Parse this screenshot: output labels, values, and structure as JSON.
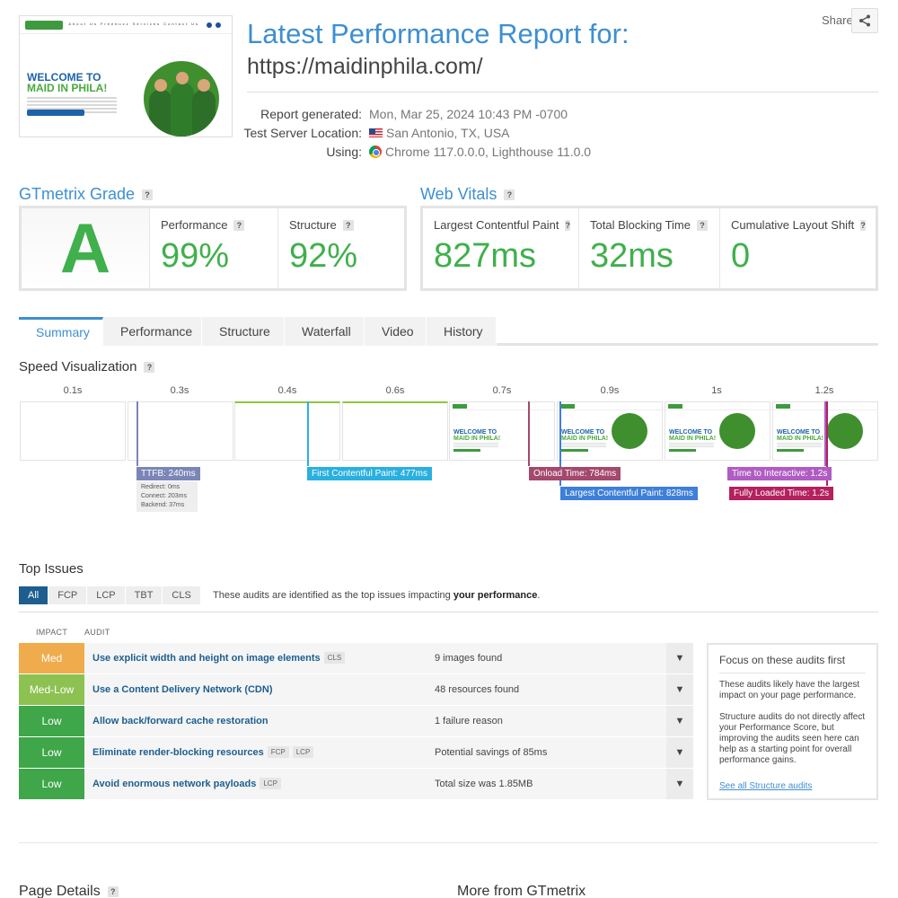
{
  "header": {
    "title": "Latest Performance Report for:",
    "url": "https://maidinphila.com/",
    "share_label": "Share",
    "share_icon": "share-icon",
    "thumbnail": {
      "welcome_line1": "WELCOME TO",
      "welcome_line2": "MAID IN PHILA!",
      "nav_links": "About Us   Freebuzz   Services   Contact Us"
    },
    "meta": [
      {
        "label": "Report generated:",
        "value": "Mon, Mar 25, 2024 10:43 PM -0700",
        "icon": ""
      },
      {
        "label": "Test Server Location:",
        "value": "San Antonio, TX, USA",
        "icon": "us-flag-icon"
      },
      {
        "label": "Using:",
        "value": "Chrome 117.0.0.0, Lighthouse 11.0.0",
        "icon": "chrome-icon"
      }
    ]
  },
  "grade": {
    "title": "GTmetrix Grade",
    "letter": "A",
    "performance_label": "Performance",
    "performance_value": "99%",
    "structure_label": "Structure",
    "structure_value": "92%"
  },
  "vitals": {
    "title": "Web Vitals",
    "items": [
      {
        "label": "Largest Contentful Paint",
        "value": "827ms"
      },
      {
        "label": "Total Blocking Time",
        "value": "32ms"
      },
      {
        "label": "Cumulative Layout Shift",
        "value": "0"
      }
    ]
  },
  "tabs": [
    "Summary",
    "Performance",
    "Structure",
    "Waterfall",
    "Video",
    "History"
  ],
  "active_tab": "Summary",
  "speed": {
    "title": "Speed Visualization",
    "times": [
      "0.1s",
      "0.3s",
      "0.4s",
      "0.6s",
      "0.7s",
      "0.9s",
      "1s",
      "1.2s"
    ],
    "markers": {
      "ttfb": "TTFB: 240ms",
      "redirect": "Redirect: 0ms",
      "connect": "Connect: 203ms",
      "backend": "Backend: 37ms",
      "fcp": "First Contentful Paint: 477ms",
      "onload": "Onload Time: 784ms",
      "lcp": "Largest Contentful Paint: 828ms",
      "tti": "Time to Interactive: 1.2s",
      "fully_loaded": "Fully Loaded Time: 1.2s"
    },
    "frame_text_1": "WELCOME TO",
    "frame_text_2": "MAID IN PHILA!"
  },
  "issues": {
    "title": "Top Issues",
    "filters": [
      "All",
      "FCP",
      "LCP",
      "TBT",
      "CLS"
    ],
    "active_filter": "All",
    "desc_prefix": "These audits are identified as the top issues impacting ",
    "desc_bold": "your performance",
    "desc_suffix": ".",
    "col_impact": "IMPACT",
    "col_audit": "AUDIT",
    "rows": [
      {
        "impact": "Med",
        "color": "#f0ac4c",
        "audit": "Use explicit width and height on image elements",
        "tags": [
          "CLS"
        ],
        "result": "9 images found"
      },
      {
        "impact": "Med-Low",
        "color": "#8dc152",
        "audit": "Use a Content Delivery Network (CDN)",
        "tags": [],
        "result": "48 resources found"
      },
      {
        "impact": "Low",
        "color": "#3fa64a",
        "audit": "Allow back/forward cache restoration",
        "tags": [],
        "result": "1 failure reason"
      },
      {
        "impact": "Low",
        "color": "#3fa64a",
        "audit": "Eliminate render-blocking resources",
        "tags": [
          "FCP",
          "LCP"
        ],
        "result": "Potential savings of 85ms"
      },
      {
        "impact": "Low",
        "color": "#3fa64a",
        "audit": "Avoid enormous network payloads",
        "tags": [
          "LCP"
        ],
        "result": "Total size was 1.85MB"
      }
    ]
  },
  "focus": {
    "title": "Focus on these audits first",
    "p1": "These audits likely have the largest impact on your page performance.",
    "p2": "Structure audits do not directly affect your Performance Score, but improving the audits seen here can help as a starting point for overall performance gains.",
    "link": "See all Structure audits"
  },
  "bottom": {
    "page_details": "Page Details",
    "more_from": "More from GTmetrix"
  },
  "colors": {
    "accent": "#3d8fd1",
    "grade_green": "#3fb04b",
    "ttfb": "#7a86b8",
    "fcp": "#2ab0e0",
    "onload": "#a5486e",
    "lcp": "#3d7fd9",
    "tti": "#b05cc4",
    "fully_loaded": "#b3215e"
  }
}
